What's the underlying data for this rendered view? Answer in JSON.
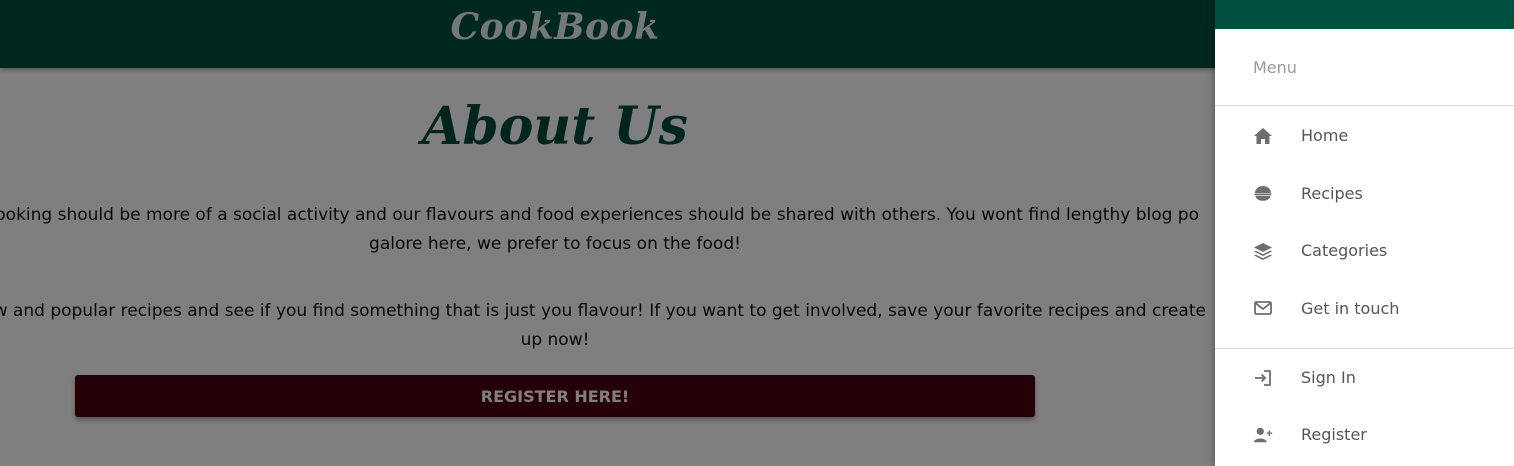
{
  "navbar": {
    "brand": "CookBook"
  },
  "main": {
    "title": "About Us",
    "paragraph1": [
      "ve cooking should be more of a social activity and our flavours and food experiences should be shared with others. You wont find lengthy blog po",
      "galore here, we prefer to focus on the food!"
    ],
    "paragraph2": [
      "r new and popular recipes and see if you find something that is just you flavour! If you want to get involved, save your favorite recipes and create",
      "up now!"
    ],
    "register_button": "REGISTER HERE!"
  },
  "sidenav": {
    "header": "Menu",
    "items": [
      {
        "label": "Home",
        "icon": "home-icon"
      },
      {
        "label": "Recipes",
        "icon": "recipe-bowl-icon"
      },
      {
        "label": "Categories",
        "icon": "layers-icon"
      },
      {
        "label": "Get in touch",
        "icon": "envelope-icon"
      }
    ],
    "account_items": [
      {
        "label": "Sign In",
        "icon": "sign-in-icon"
      },
      {
        "label": "Register",
        "icon": "user-plus-icon"
      }
    ]
  },
  "colors": {
    "brand_green": "#005040",
    "title_green": "#004a3a",
    "button_maroon": "#4a0010",
    "overlay": "rgba(0,0,0,0.5)"
  }
}
